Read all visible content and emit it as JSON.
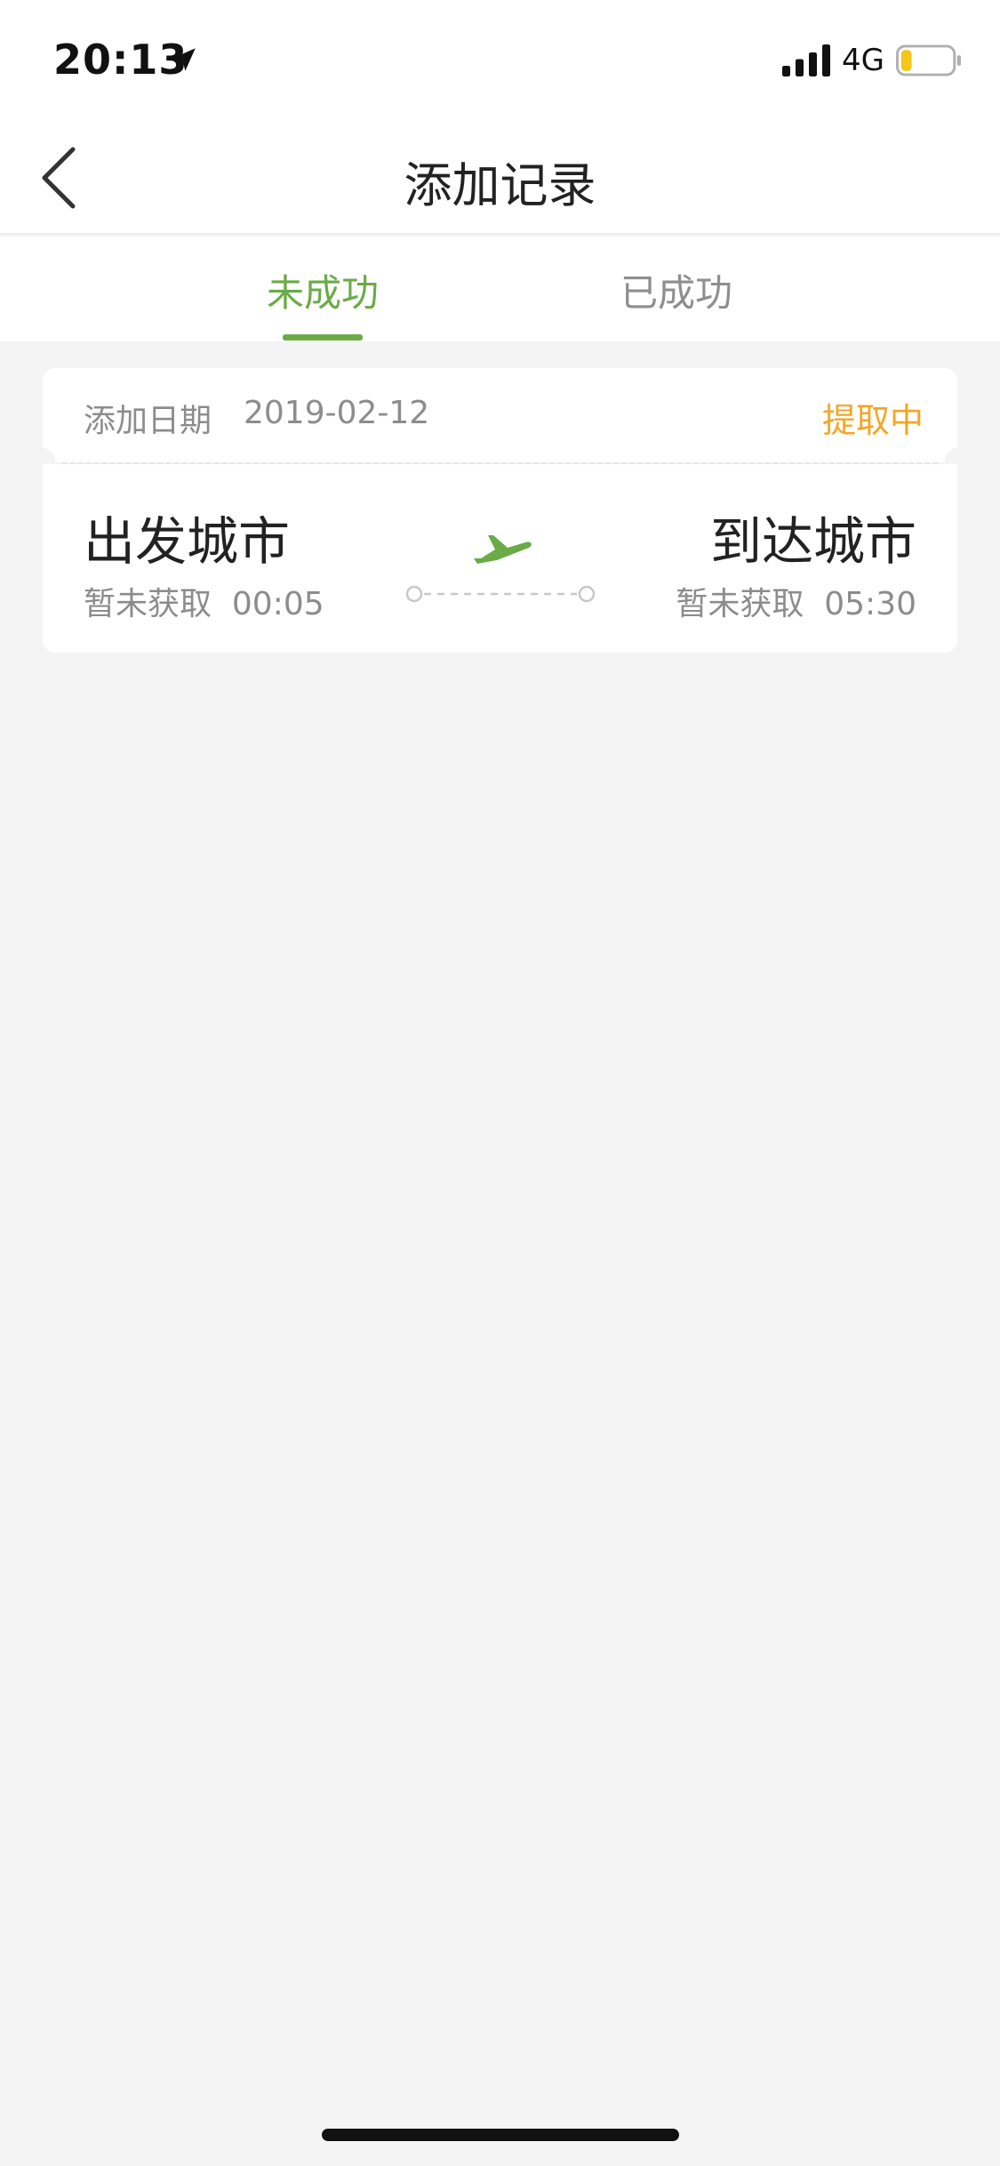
{
  "status_bar": {
    "time": "20:13",
    "network": "4G"
  },
  "nav": {
    "title": "添加记录"
  },
  "tabs": [
    {
      "label": "未成功",
      "active": true
    },
    {
      "label": "已成功",
      "active": false
    }
  ],
  "record": {
    "date_label": "添加日期",
    "date_value": "2019-02-12",
    "status": "提取中",
    "departure": {
      "city": "出发城市",
      "info": "暂未获取",
      "time": "00:05"
    },
    "arrival": {
      "city": "到达城市",
      "info": "暂未获取",
      "time": "05:30"
    }
  },
  "colors": {
    "accent_green": "#6aab47",
    "status_orange": "#f5a623",
    "background": "#f4f4f4"
  }
}
